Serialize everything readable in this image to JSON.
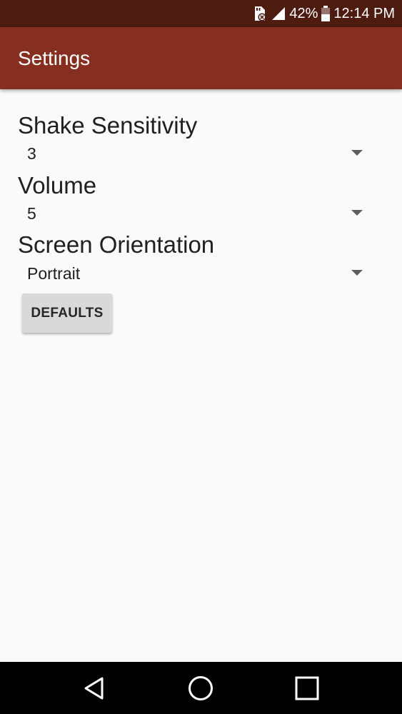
{
  "status_bar": {
    "icons": [
      "sd-card-error-icon",
      "signal-icon",
      "battery-icon"
    ],
    "battery": "42%",
    "time": "12:14 PM"
  },
  "app_bar": {
    "title": "Settings",
    "color": "#862f20"
  },
  "settings": [
    {
      "label": "Shake Sensitivity",
      "value": "3"
    },
    {
      "label": "Volume",
      "value": "5"
    },
    {
      "label": "Screen Orientation",
      "value": "Portrait"
    }
  ],
  "defaults_button": {
    "label": "DEFAULTS"
  },
  "nav_bar": {
    "buttons": [
      "back-icon",
      "home-icon",
      "recents-icon"
    ]
  }
}
